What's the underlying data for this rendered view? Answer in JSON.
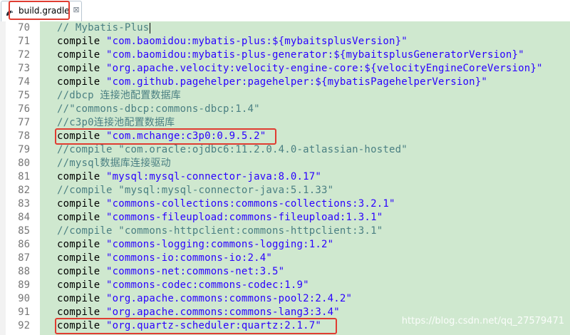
{
  "tab": {
    "title": "build.gradle",
    "close_glyph": "⊠"
  },
  "lines": [
    {
      "no": "70",
      "type": "comment",
      "text": "// Mybatis-Plus"
    },
    {
      "no": "71",
      "type": "code",
      "kw": "compile ",
      "str": "\"com.baomidou:mybatis-plus:${mybaitsplusVersion}\""
    },
    {
      "no": "72",
      "type": "code",
      "kw": "compile ",
      "str": "\"com.baomidou:mybatis-plus-generator:${mybaitsplusGeneratorVersion}\""
    },
    {
      "no": "73",
      "type": "code",
      "kw": "compile ",
      "str": "\"org.apache.velocity:velocity-engine-core:${velocityEngineCoreVersion}\""
    },
    {
      "no": "74",
      "type": "code",
      "kw": "compile ",
      "str": "\"com.github.pagehelper:pagehelper:${mybatisPagehelperVersion}\""
    },
    {
      "no": "75",
      "type": "comment",
      "text": "//dbcp 连接池配置数据库"
    },
    {
      "no": "76",
      "type": "comment",
      "text": "//\"commons-dbcp:commons-dbcp:1.4\""
    },
    {
      "no": "77",
      "type": "comment",
      "text": "//c3p0连接池配置数据库"
    },
    {
      "no": "78",
      "type": "code",
      "kw": "compile ",
      "str": "\"com.mchange:c3p0:0.9.5.2\""
    },
    {
      "no": "79",
      "type": "comment",
      "text": "//compile \"com.oracle:ojdbc6:11.2.0.4.0-atlassian-hosted\""
    },
    {
      "no": "80",
      "type": "comment",
      "text": "//mysql数据库连接驱动"
    },
    {
      "no": "81",
      "type": "code",
      "kw": "compile ",
      "str": "\"mysql:mysql-connector-java:8.0.17\""
    },
    {
      "no": "82",
      "type": "comment",
      "text": "//compile \"mysql:mysql-connector-java:5.1.33\""
    },
    {
      "no": "83",
      "type": "code",
      "kw": "compile ",
      "str": "\"commons-collections:commons-collections:3.2.1\""
    },
    {
      "no": "84",
      "type": "code",
      "kw": "compile ",
      "str": "\"commons-fileupload:commons-fileupload:1.3.1\""
    },
    {
      "no": "85",
      "type": "comment",
      "text": "//compile \"commons-httpclient:commons-httpclient:3.1\""
    },
    {
      "no": "86",
      "type": "code",
      "kw": "compile ",
      "str": "\"commons-logging:commons-logging:1.2\""
    },
    {
      "no": "87",
      "type": "code",
      "kw": "compile ",
      "str": "\"commons-io:commons-io:2.4\""
    },
    {
      "no": "88",
      "type": "code",
      "kw": "compile ",
      "str": "\"commons-net:commons-net:3.5\""
    },
    {
      "no": "89",
      "type": "code",
      "kw": "compile ",
      "str": "\"commons-codec:commons-codec:1.9\""
    },
    {
      "no": "90",
      "type": "code",
      "kw": "compile ",
      "str": "\"org.apache.commons:commons-pool2:2.4.2\""
    },
    {
      "no": "91",
      "type": "code",
      "kw": "compile ",
      "str": "\"org.apache.commons:commons-lang3:3.4\""
    },
    {
      "no": "92",
      "type": "code",
      "kw": "compile ",
      "str": "\"org.quartz-scheduler:quartz:2.1.7\""
    }
  ],
  "watermark": "https://blog.csdn.net/qq_27579471",
  "colors": {
    "editor_bg": "#cfe8cf",
    "keyword": "#000000",
    "string": "#2a00ff",
    "comment": "#4a7f82",
    "highlight_box": "#e03c31"
  }
}
